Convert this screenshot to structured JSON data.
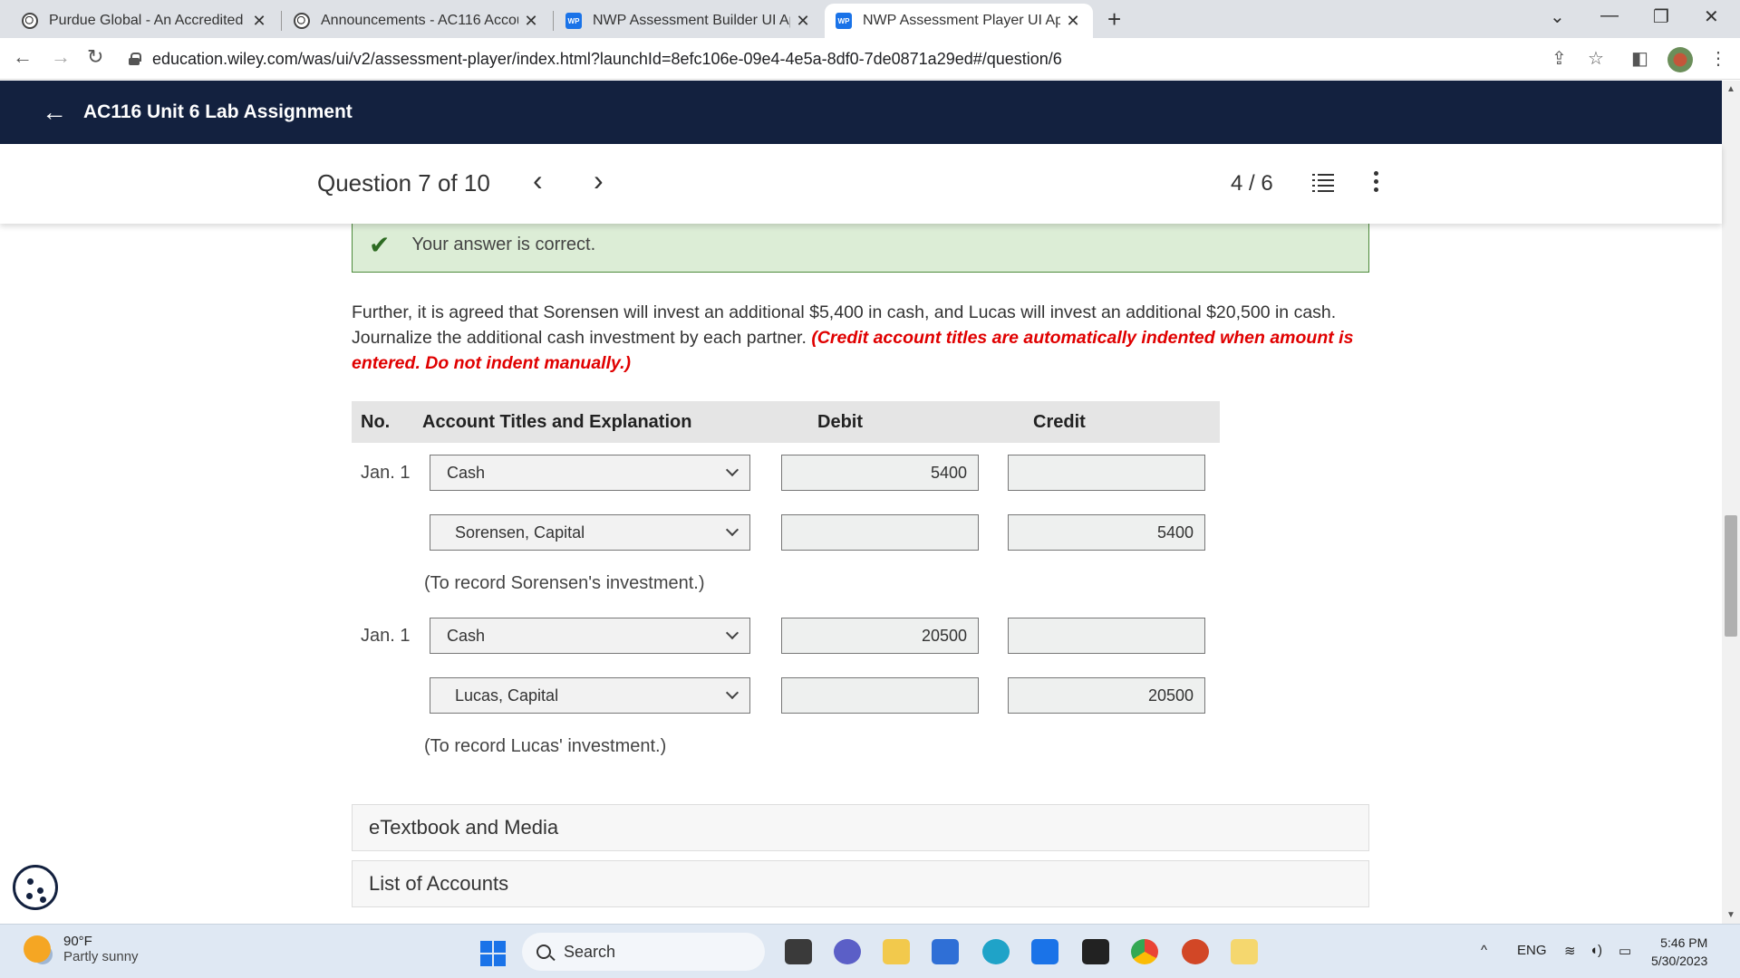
{
  "browser": {
    "tabs": [
      {
        "title": "Purdue Global - An Accredited O",
        "active": false,
        "favicon": "purdue-logo"
      },
      {
        "title": "Announcements - AC116 Accoun",
        "active": false,
        "favicon": "purdue-logo"
      },
      {
        "title": "NWP Assessment Builder UI Appl",
        "active": false,
        "favicon": "wp-logo"
      },
      {
        "title": "NWP Assessment Player UI Appli",
        "active": true,
        "favicon": "wp-logo"
      }
    ],
    "url": "education.wiley.com/was/ui/v2/assessment-player/index.html?launchId=8efc106e-09e4-4e5a-8df0-7de0871a29ed#/question/6",
    "icons": {
      "new_tab": "+",
      "close": "✕",
      "minimize": "—",
      "restore": "❐",
      "window_close": "✕",
      "tab_list": "⌄",
      "back": "←",
      "forward": "→",
      "reload": "↻",
      "share": "⇪",
      "bookmark": "☆",
      "sidepanel": "◧",
      "menu": "⋮"
    }
  },
  "app": {
    "back_icon": "←",
    "title": "AC116 Unit 6 Lab Assignment",
    "question_label": "Question 7 of 10",
    "prev_icon": "‹",
    "next_icon": "›",
    "attempt": "4 / 6"
  },
  "feedback": {
    "check_icon": "✔",
    "message": "Your answer is correct."
  },
  "instructions": {
    "text": "Further, it is agreed that Sorensen will invest an additional $5,400 in cash, and Lucas will invest an additional $20,500 in cash. Journalize the additional cash investment by each partner.",
    "warning": "(Credit account titles are automatically indented when amount is entered. Do not indent manually.)"
  },
  "journal": {
    "headers": {
      "no": "No.",
      "account": "Account Titles and Explanation",
      "debit": "Debit",
      "credit": "Credit"
    },
    "entries": [
      {
        "date": "Jan. 1",
        "lines": [
          {
            "account": "Cash",
            "debit": "5400",
            "credit": ""
          },
          {
            "account": "Sorensen, Capital",
            "debit": "",
            "credit": "5400"
          }
        ],
        "explanation": "(To record Sorensen's investment.)"
      },
      {
        "date": "Jan. 1",
        "lines": [
          {
            "account": "Cash",
            "debit": "20500",
            "credit": ""
          },
          {
            "account": "Lucas, Capital",
            "debit": "",
            "credit": "20500"
          }
        ],
        "explanation": "(To record Lucas' investment.)"
      }
    ]
  },
  "accordions": [
    "eTextbook and Media",
    "List of Accounts"
  ],
  "taskbar": {
    "weather_temp": "90°F",
    "weather_desc": "Partly sunny",
    "search": "Search",
    "language": "ENG",
    "time": "5:46 PM",
    "date": "5/30/2023"
  },
  "colors": {
    "header_bg": "#13213f",
    "success_bg": "#dcedd6",
    "success_border": "#4d8a3a",
    "warning_text": "#e00000"
  }
}
